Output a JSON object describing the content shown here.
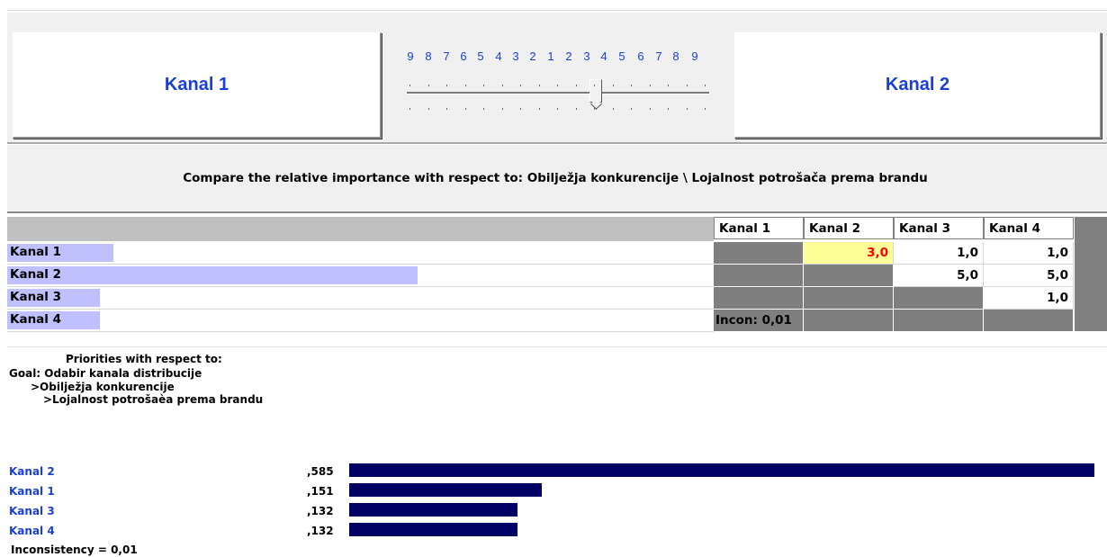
{
  "compare": {
    "left_label": "Kanal 1",
    "right_label": "Kanal 2",
    "scale_numbers": [
      "9",
      "8",
      "7",
      "6",
      "5",
      "4",
      "3",
      "2",
      "1",
      "2",
      "3",
      "4",
      "5",
      "6",
      "7",
      "8",
      "9"
    ],
    "prompt": "Compare the relative importance with respect to: Obilježja konkurencije  \\ Lojalnost potrošača prema brandu"
  },
  "matrix": {
    "columns": [
      "Kanal 1",
      "Kanal 2",
      "Kanal 3",
      "Kanal 4"
    ],
    "rows": [
      {
        "label": "Kanal 1",
        "priority": 0.151,
        "cells": [
          "",
          "3,0",
          "1,0",
          "1,0"
        ]
      },
      {
        "label": "Kanal 2",
        "priority": 0.585,
        "cells": [
          "",
          "",
          "5,0",
          "5,0"
        ]
      },
      {
        "label": "Kanal 3",
        "priority": 0.132,
        "cells": [
          "",
          "",
          "",
          "1,0"
        ]
      },
      {
        "label": "Kanal 4",
        "priority": 0.132,
        "cells": [
          "Incon: 0,01",
          "",
          "",
          ""
        ]
      }
    ]
  },
  "priorities": {
    "title": "Priorities with respect to:",
    "goal": "Goal: Odabir kanala distribucije",
    "level1": ">Obilježja konkurencije",
    "level2": ">Lojalnost potrošaèa prema brandu",
    "items": [
      {
        "name": "Kanal 2",
        "value_label": ",585",
        "value": 0.585
      },
      {
        "name": "Kanal 1",
        "value_label": ",151",
        "value": 0.151
      },
      {
        "name": "Kanal 3",
        "value_label": ",132",
        "value": 0.132
      },
      {
        "name": "Kanal 4",
        "value_label": ",132",
        "value": 0.132
      }
    ],
    "inconsistency": "Inconsistency = 0,01"
  },
  "colors": {
    "accent": "#1a3fd6",
    "bar": "#000064",
    "label_bar": "#c0c0ff",
    "selected_cell": "#ffff99",
    "selected_text": "#ff0000",
    "gray_cell": "#7f7f7f"
  }
}
